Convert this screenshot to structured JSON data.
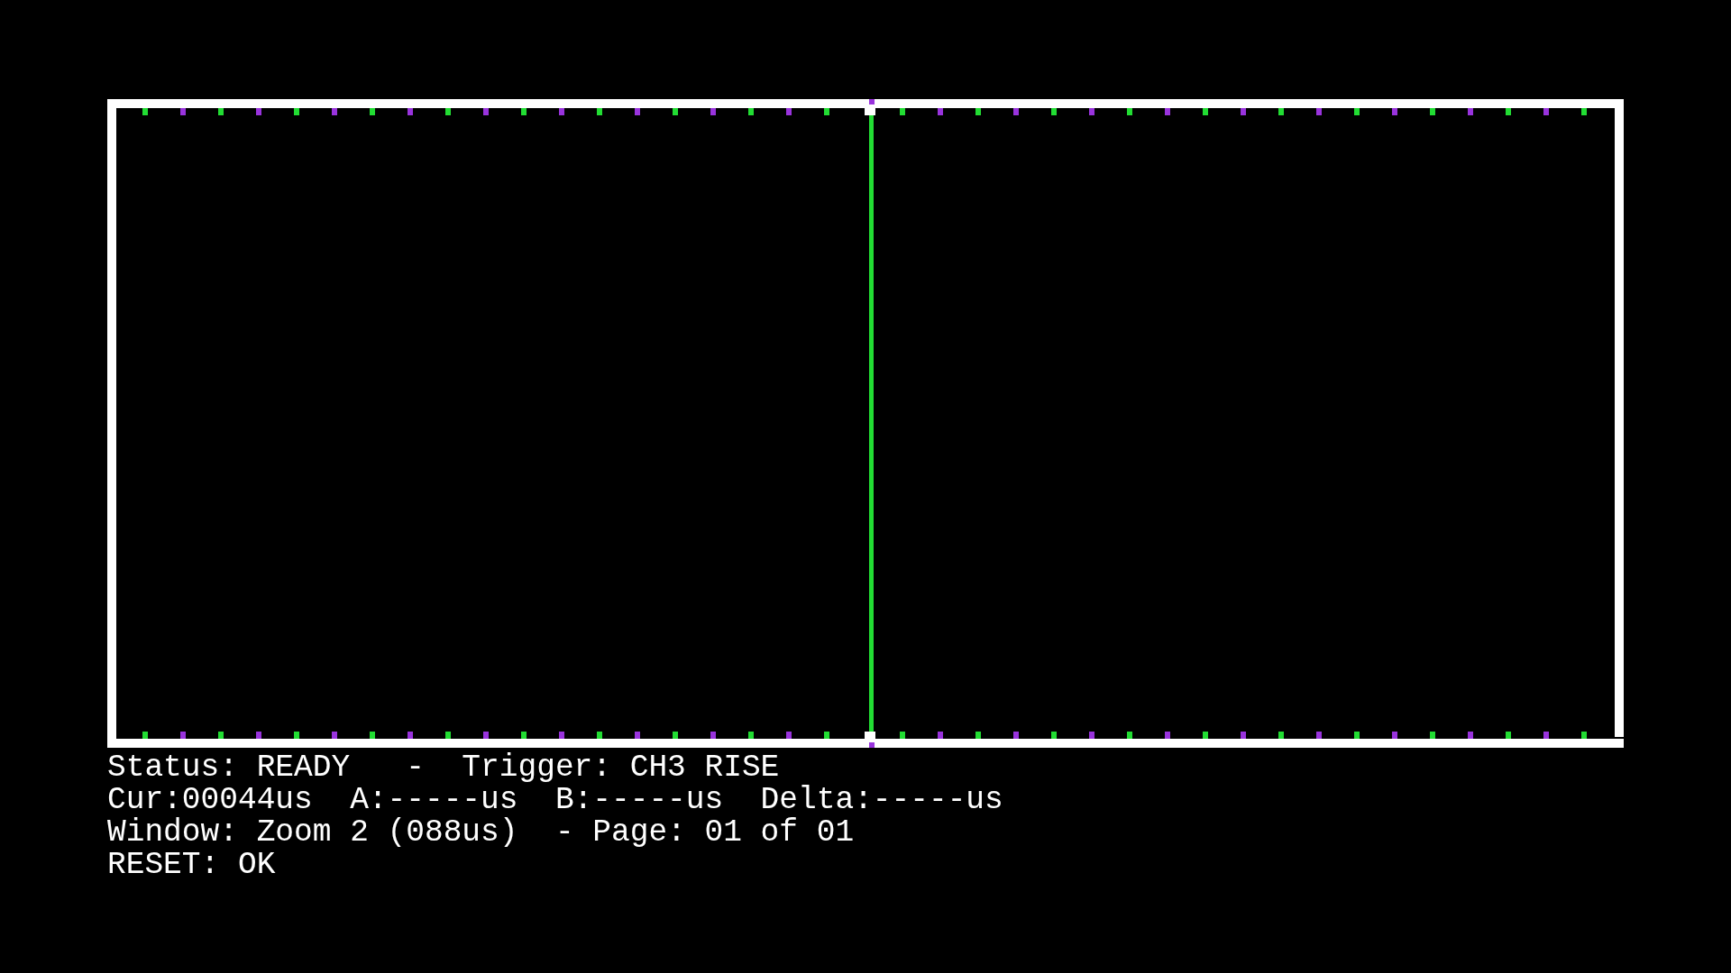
{
  "status_lines": [
    "Status: READY   -  Trigger: CH3 RISE",
    "Cur:00044us  A:-----us  B:-----us  Delta:-----us",
    "Window: Zoom 2 (088us)  - Page: 01 of 01",
    "RESET: OK"
  ]
}
